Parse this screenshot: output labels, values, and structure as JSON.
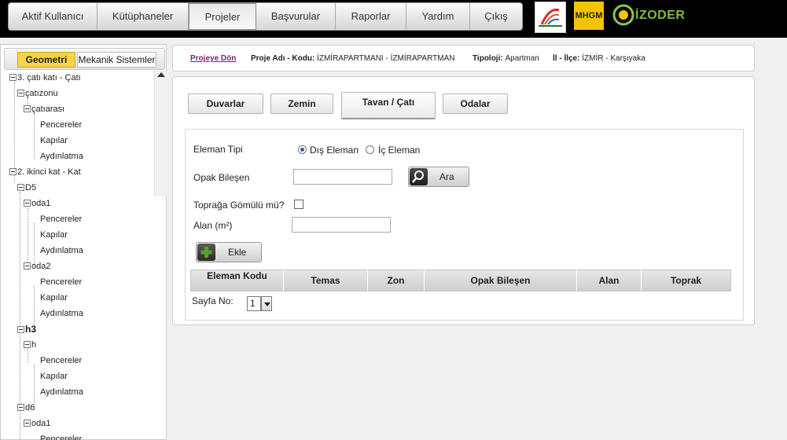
{
  "nav": {
    "items": [
      "Aktif Kullanıcı",
      "Kütüphaneler",
      "Projeler",
      "Başvurular",
      "Raporlar",
      "Yardım",
      "Çıkış"
    ],
    "active_index": 2
  },
  "logos": {
    "mhgm": "MHGM",
    "izoder": "İZODER"
  },
  "left": {
    "tabs": [
      "Geometri",
      "Mekanik Sistemler"
    ],
    "active_tab": "Geometri",
    "tree": [
      "3. çatı katı - Çatı",
      "çatızonu",
      "çatıarası",
      "Pencereler",
      "Kapılar",
      "Aydınlatma",
      "2. ikinci kat - Kat",
      "D5",
      "oda1",
      "Pencereler",
      "Kapılar",
      "Aydınlatma",
      "oda2",
      "Pencereler",
      "Kapılar",
      "Aydınlatma",
      "h3",
      "h",
      "Pencereler",
      "Kapılar",
      "Aydınlatma",
      "d6",
      "oda1",
      "Pencereler"
    ]
  },
  "info": {
    "back_link": "Projeye Dön",
    "project_label": "Proje Adı - Kodu:",
    "project_value": "İZMİRAPARTMANI - İZMİRAPARTMAN",
    "typology_label": "Tipoloji:",
    "typology_value": "Apartman",
    "location_label": "İl - İlçe:",
    "location_value": "İZMİR - Karşıyaka"
  },
  "tabs": [
    "Duvarlar",
    "Zemin",
    "Tavan / Çatı",
    "Odalar"
  ],
  "active_tab": "Tavan / Çatı",
  "form": {
    "element_type_label": "Eleman Tipi",
    "radio_outer": "Dış Eleman",
    "radio_inner": "İç Eleman",
    "radio_selected": "Dış Eleman",
    "opaque_label": "Opak Bileşen",
    "opaque_value": "",
    "search_button": "Ara",
    "buried_label": "Toprağa Gömülü mü?",
    "buried_checked": false,
    "area_label": "Alan (m²)",
    "area_value": "",
    "add_button": "Ekle"
  },
  "table": {
    "headers": [
      "Eleman Kodu",
      "Temas",
      "Zon",
      "Opak Bileşen",
      "Alan",
      "Toprak"
    ],
    "rows": []
  },
  "pager": {
    "label": "Sayfa No:",
    "page": "1"
  },
  "colors": {
    "active_tab_bg": "#f7d34a",
    "topbar": "#000000",
    "link": "#7b1f73",
    "radio_dot": "#2a5fb3",
    "add_icon": "#5aa02c"
  }
}
